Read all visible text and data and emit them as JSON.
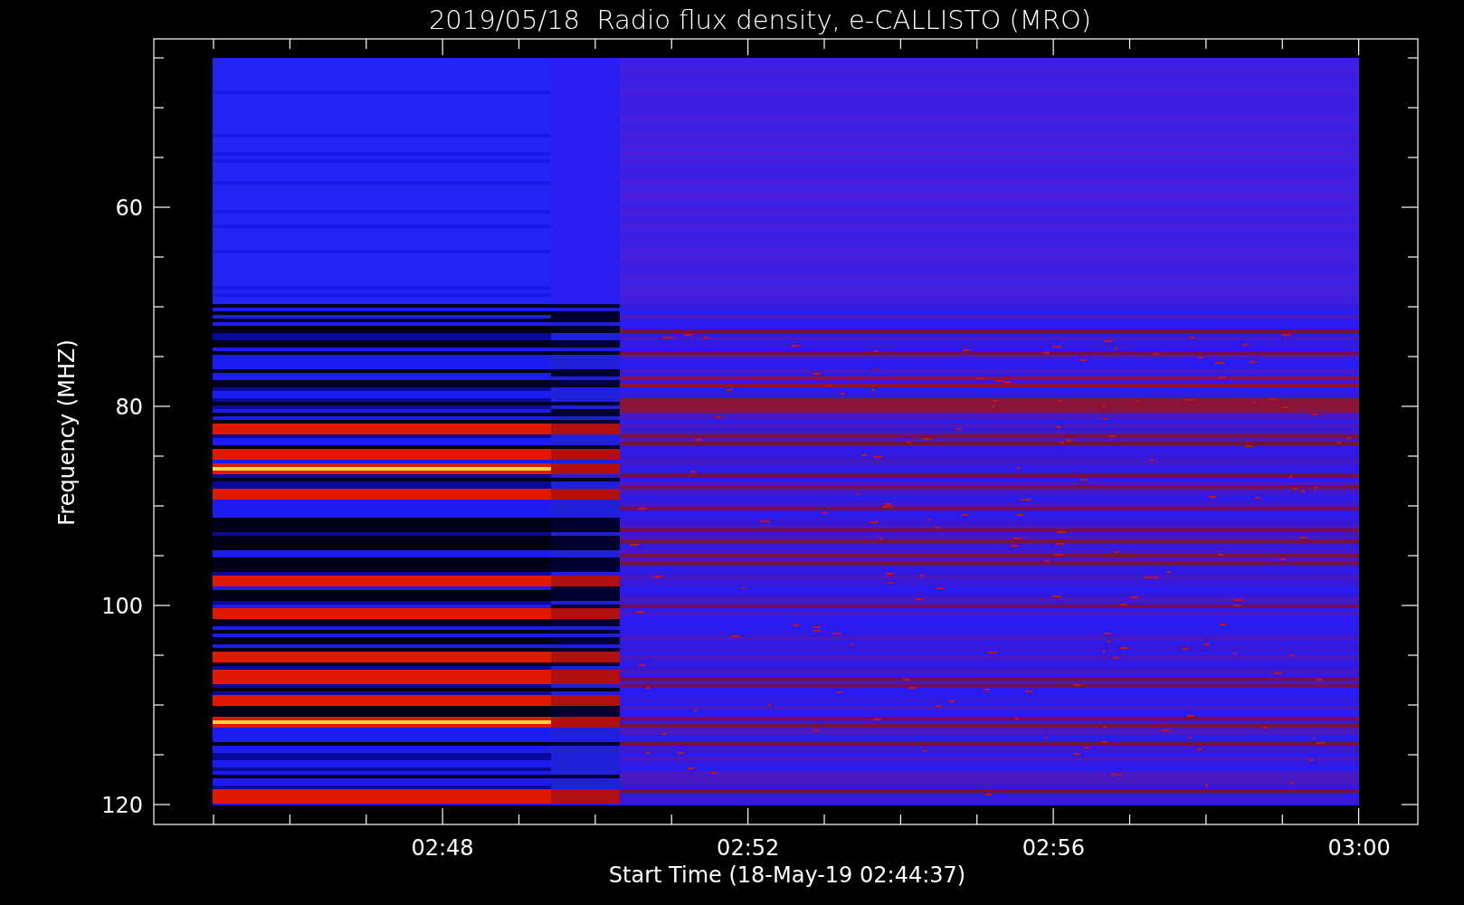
{
  "title": "2019/05/18  Radio flux density, e-CALLISTO (MRO)",
  "y_axis": {
    "label": "Frequency (MHZ)",
    "ticks": [
      "60",
      "80",
      "100",
      "120"
    ]
  },
  "x_axis": {
    "label": "Start Time (18-May-19 02:44:37)",
    "ticks": [
      "02:48",
      "02:52",
      "02:56",
      "03:00"
    ]
  }
}
